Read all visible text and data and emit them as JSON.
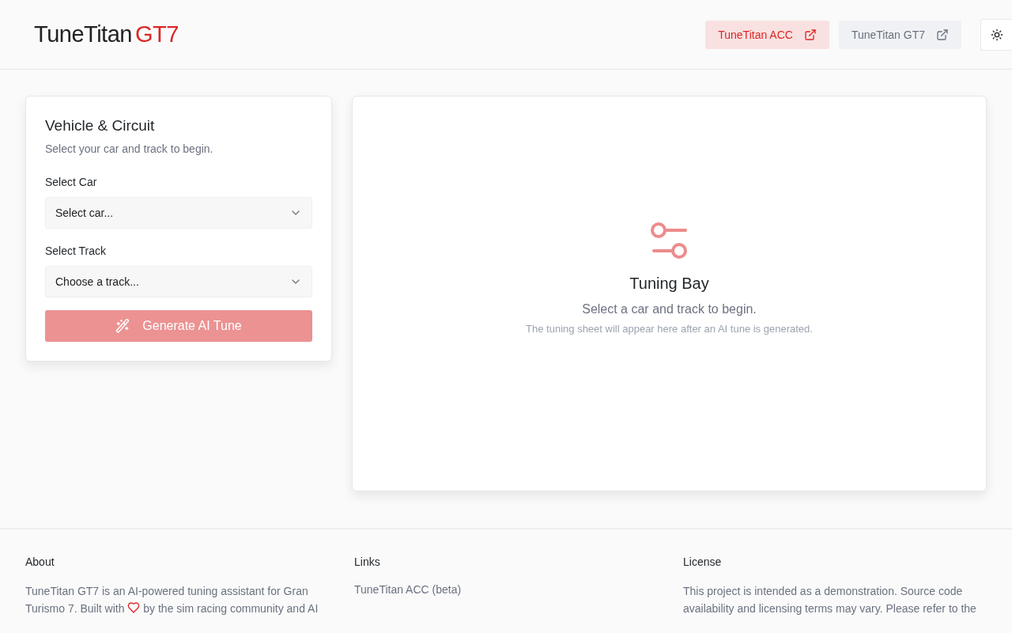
{
  "header": {
    "brand": {
      "name": "TuneTitan",
      "accent": "GT7"
    },
    "links": [
      {
        "label": "TuneTitan ACC",
        "selected": true
      },
      {
        "label": "TuneTitan GT7",
        "selected": false
      }
    ]
  },
  "form": {
    "title": "Vehicle & Circuit",
    "subtitle": "Select your car and track to begin.",
    "fields": [
      {
        "label": "Select Car",
        "placeholder": "Select car..."
      },
      {
        "label": "Select Track",
        "placeholder": "Choose a track..."
      }
    ],
    "button": {
      "label": "Generate AI Tune",
      "disabled": true
    }
  },
  "tuning_bay": {
    "title": "Tuning Bay",
    "message": "Select a car and track to begin.",
    "hint": "The tuning sheet will appear here after an AI tune is generated."
  },
  "footer": {
    "about": {
      "title": "About",
      "line_1": "TuneTitan GT7 is an AI-powered tuning assistant for Gran",
      "text_before": "Turismo 7. Built with",
      "text_after": "by the sim racing community and AI"
    },
    "links": {
      "title": "Links",
      "items": [
        "TuneTitan ACC (beta)"
      ]
    },
    "license": {
      "title": "License",
      "text": "This project is intended as a demonstration. Source code availability and licensing terms may vary. Please refer to the"
    }
  }
}
